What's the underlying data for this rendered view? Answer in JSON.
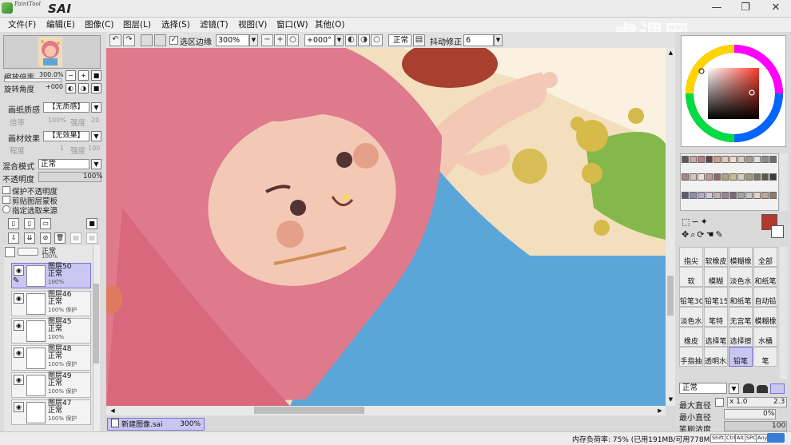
{
  "app": {
    "logo_text": "PaintTool",
    "logo_name": "SAI"
  },
  "window_controls": {
    "minimize": "—",
    "restore": "❐",
    "close": "✕"
  },
  "menu": [
    "文件(F)",
    "编辑(E)",
    "图像(C)",
    "图层(L)",
    "选择(S)",
    "滤镜(T)",
    "视图(V)",
    "窗口(W)",
    "其他(O)"
  ],
  "toolbar": {
    "selection_edge_label": "选区边缘",
    "selection_edge_checked": true,
    "zoom": "300%",
    "rotation": "+000°",
    "blend_mode": "正常",
    "stabilizer_label": "抖动修正",
    "stabilizer_value": "6"
  },
  "navigator": {
    "zoom_label": "缩放倍率",
    "zoom_value": "300.0%",
    "rotate_label": "旋转角度",
    "rotate_value": "+000"
  },
  "paper": {
    "texture_label": "画纸质感",
    "texture_value": "【无质感】",
    "scale_label": "倍率",
    "scale_value": "100%",
    "strength_label": "强度",
    "strength_value": "20",
    "effect_label": "画材效果",
    "effect_value": "【无效果】",
    "degree_label": "程度",
    "degree_value": "1",
    "effect_strength_label": "强度",
    "effect_strength_value": "100"
  },
  "layer_props": {
    "blend_label": "混合模式",
    "blend_value": "正常",
    "opacity_label": "不透明度",
    "opacity_value": "100%",
    "protect_opacity": "保护不透明度",
    "clip_group": "剪贴图层蒙板",
    "selection_source": "指定选取来源"
  },
  "layers": {
    "top_group": {
      "mode": "正常",
      "opacity": "100%"
    },
    "items": [
      {
        "name": "图层50",
        "mode": "正常",
        "opacity": "100%",
        "selected": true
      },
      {
        "name": "图层46",
        "mode": "正常",
        "opacity": "100% 保护",
        "selected": false
      },
      {
        "name": "图层45",
        "mode": "正常",
        "opacity": "100%",
        "selected": false
      },
      {
        "name": "图层48",
        "mode": "正常",
        "opacity": "100% 保护",
        "selected": false
      },
      {
        "name": "图层49",
        "mode": "正常",
        "opacity": "100% 保护",
        "selected": false
      },
      {
        "name": "图层47",
        "mode": "正常",
        "opacity": "100% 保护",
        "selected": false
      }
    ]
  },
  "colors": {
    "current_primary": "#b03a2e",
    "current_secondary": "#ffffff",
    "swatches": [
      "#5a5a5a",
      "#c9a7a7",
      "#b07f7f",
      "#6b3f3f",
      "#c8a08c",
      "#e6c8b4",
      "#f2d8c9",
      "#d9cbbf",
      "#a89a93",
      "#e0e0e0",
      "#8c8c8c",
      "#6e6e6e",
      "#9e8a87",
      "#dcc2bc",
      "#efe0da",
      "#c09a92",
      "#8e6b66",
      "#b59f7d",
      "#cbbd8f",
      "#d8d0b0",
      "#a3977a",
      "#7d7560",
      "#5e584a",
      "#3e3a33",
      "#5b5b73",
      "#8d8dab",
      "#b5a9c9",
      "#d6c9dc",
      "#c7b0b5",
      "#9d8590",
      "#7b6a76",
      "#a4a4a4",
      "#c5c5c5",
      "#e6d3c6",
      "#bda493",
      "#927a6c"
    ]
  },
  "tools": [
    {
      "label": "指尖",
      "selected": false
    },
    {
      "label": "软橡皮",
      "selected": false
    },
    {
      "label": "模糊橡",
      "selected": false
    },
    {
      "label": "全部",
      "selected": false
    },
    {
      "label": "软",
      "selected": false
    },
    {
      "label": "模糊",
      "selected": false
    },
    {
      "label": "淡色水",
      "selected": false
    },
    {
      "label": "和纸笔",
      "selected": false
    },
    {
      "label": "铅笔30",
      "selected": false
    },
    {
      "label": "铅笔15",
      "selected": false
    },
    {
      "label": "和纸笔",
      "selected": false
    },
    {
      "label": "自动铅",
      "selected": false
    },
    {
      "label": "淡色水",
      "selected": false
    },
    {
      "label": "笔特",
      "selected": false
    },
    {
      "label": "无宫笔",
      "selected": false
    },
    {
      "label": "模糊橡",
      "selected": false
    },
    {
      "label": "橡皮",
      "selected": false
    },
    {
      "label": "选择笔",
      "selected": false
    },
    {
      "label": "选择擦",
      "selected": false
    },
    {
      "label": "水桶",
      "selected": false
    },
    {
      "label": "手指抽",
      "selected": false
    },
    {
      "label": "透明水彩",
      "selected": false
    },
    {
      "label": "铅笔",
      "selected": true
    },
    {
      "label": "笔",
      "selected": false
    }
  ],
  "brush": {
    "mode": "正常",
    "max_size_label": "最大直径",
    "max_size_mult": "x 1.0",
    "max_size_value": "2.3",
    "min_size_label": "最小直径",
    "min_size_value": "0%",
    "density_label": "笔刷浓度",
    "density_value": "100"
  },
  "document_tab": {
    "name": "新建图像.sai",
    "zoom": "300%"
  },
  "status": {
    "memory": "内存负荷率: 75% (已用191MB/可用778MB)",
    "keys": [
      "Shift",
      "Ctrl",
      "Alt",
      "SPC",
      "Any"
    ]
  },
  "watermark": "虎课网"
}
